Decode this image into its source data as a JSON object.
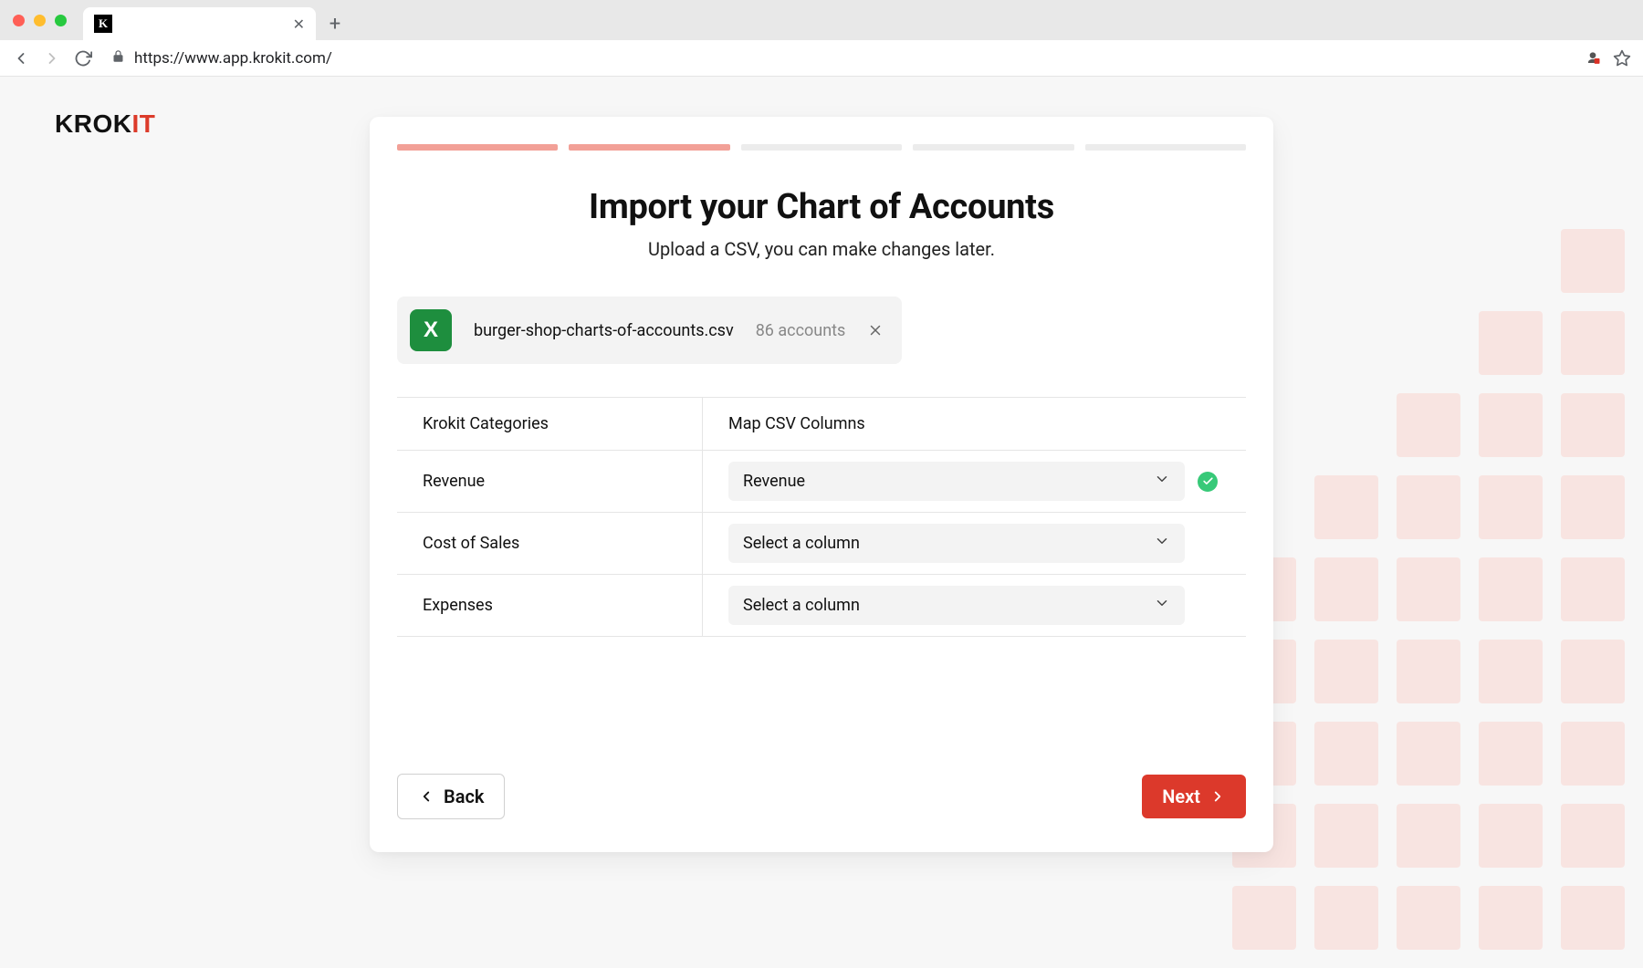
{
  "browser": {
    "tab_title": "",
    "url": "https://www.app.krokit.com/"
  },
  "brand": {
    "logo_main": "KROK",
    "logo_accent": "IT"
  },
  "wizard": {
    "total_steps": 5,
    "completed_steps": 2,
    "title": "Import your Chart of Accounts",
    "subtitle": "Upload a CSV,  you can make changes later."
  },
  "file": {
    "icon_letter": "X",
    "name": "burger-shop-charts-of-accounts.csv",
    "count_label": "86 accounts"
  },
  "mapping": {
    "header_left": "Krokit Categories",
    "header_right": "Map CSV Columns",
    "placeholder": "Select a column",
    "rows": [
      {
        "category": "Revenue",
        "selected": "Revenue",
        "ok": true
      },
      {
        "category": "Cost of Sales",
        "selected": "Select a column",
        "ok": false
      },
      {
        "category": "Expenses",
        "selected": "Select a column",
        "ok": false
      }
    ]
  },
  "actions": {
    "back": "Back",
    "next": "Next"
  },
  "colors": {
    "accent": "#dc392b",
    "step_done": "#f2a097",
    "success": "#37c978",
    "file_icon": "#1e8e3e"
  }
}
